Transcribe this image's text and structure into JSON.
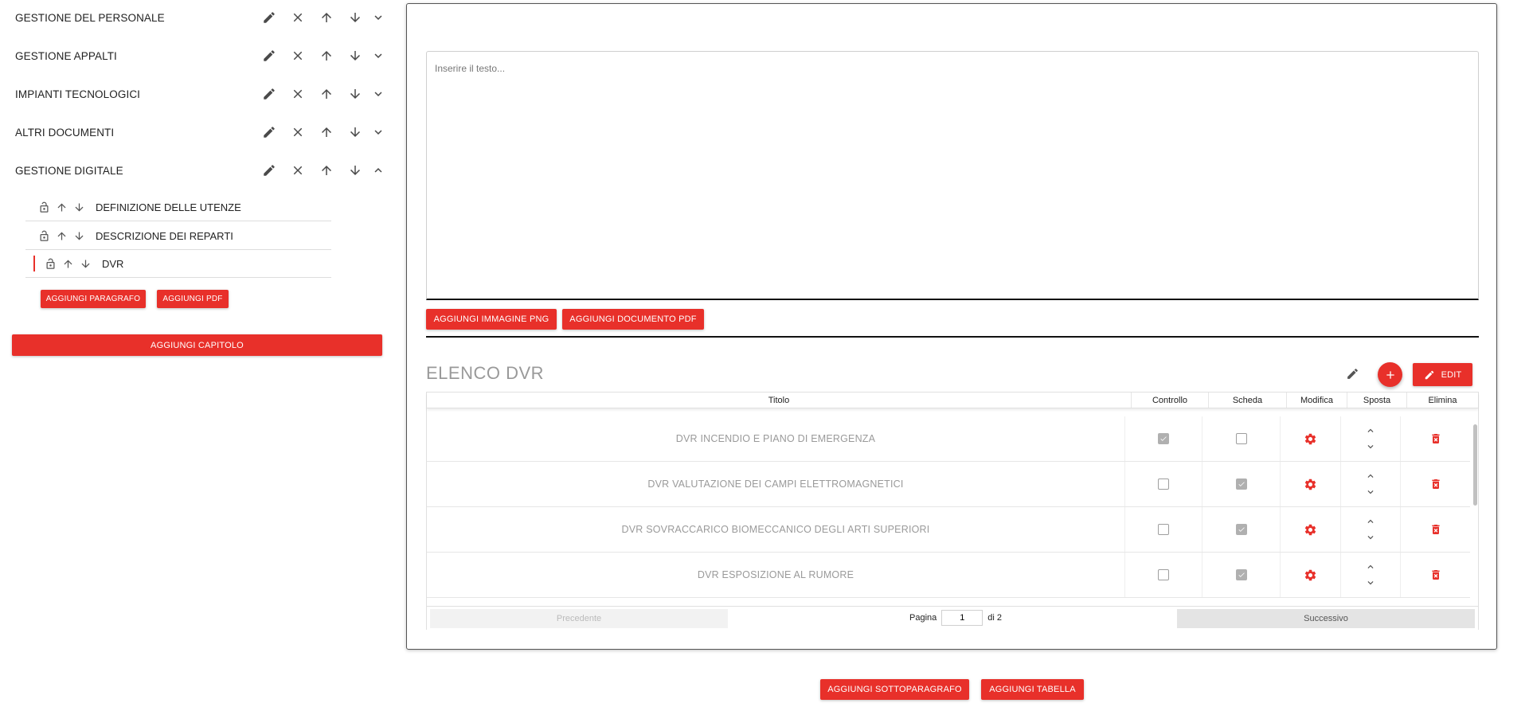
{
  "sidebar": {
    "chapters": [
      {
        "label": "GESTIONE DEL PERSONALE",
        "expanded": false
      },
      {
        "label": "GESTIONE APPALTI",
        "expanded": false
      },
      {
        "label": "IMPIANTI TECNOLOGICI",
        "expanded": false
      },
      {
        "label": "ALTRI DOCUMENTI",
        "expanded": false
      },
      {
        "label": "GESTIONE DIGITALE",
        "expanded": true
      }
    ],
    "paragraphs": [
      {
        "label": "DEFINIZIONE DELLE UTENZE",
        "active": false
      },
      {
        "label": "DESCRIZIONE DEI REPARTI",
        "active": false
      },
      {
        "label": "DVR",
        "active": true
      }
    ],
    "add_paragraph_label": "AGGIUNGI PARAGRAFO",
    "add_pdf_label": "AGGIUNGI PDF",
    "add_chapter_label": "AGGIUNGI CAPITOLO"
  },
  "editor": {
    "placeholder": "Inserire il testo...",
    "add_image_label": "AGGIUNGI IMMAGINE PNG",
    "add_document_label": "AGGIUNGI DOCUMENTO PDF"
  },
  "list": {
    "title": "ELENCO DVR",
    "edit_label": "EDIT",
    "columns": [
      "Titolo",
      "Controllo",
      "Scheda",
      "Modifica",
      "Sposta",
      "Elimina"
    ],
    "rows": [
      {
        "title": "DVR INCENDIO E PIANO DI EMERGENZA",
        "controllo": true,
        "scheda": false
      },
      {
        "title": "DVR VALUTAZIONE DEI CAMPI ELETTROMAGNETICI",
        "controllo": false,
        "scheda": true
      },
      {
        "title": "DVR SOVRACCARICO BIOMECCANICO DEGLI ARTI SUPERIORI",
        "controllo": false,
        "scheda": true
      },
      {
        "title": "DVR ESPOSIZIONE AL RUMORE",
        "controllo": false,
        "scheda": true
      }
    ],
    "pagination": {
      "prev_label": "Precedente",
      "next_label": "Successivo",
      "page_label": "Pagina",
      "current_page": "1",
      "of_label": "di 2"
    }
  },
  "footer": {
    "add_subparagraph_label": "AGGIUNGI SOTTOPARAGRAFO",
    "add_table_label": "AGGIUNGI TABELLA"
  },
  "colors": {
    "accent": "#e8302a",
    "muted_text": "#999999"
  }
}
